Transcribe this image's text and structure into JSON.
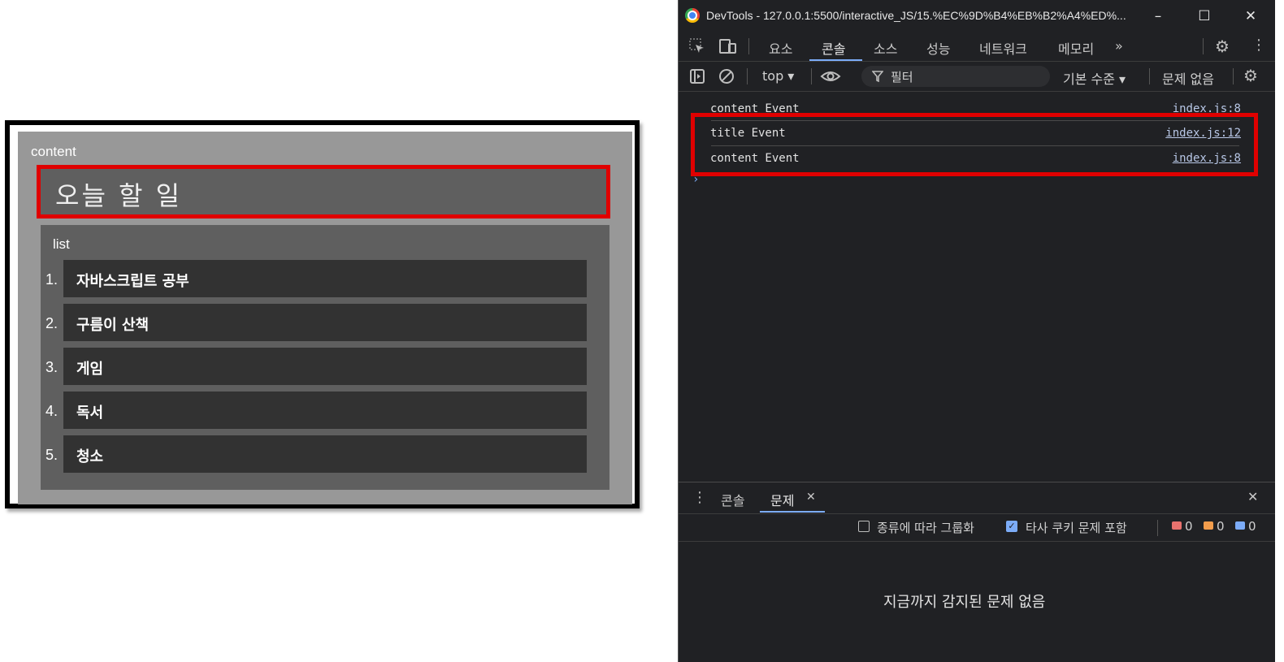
{
  "preview": {
    "content_label": "content",
    "title": "오늘 할 일",
    "list_label": "list",
    "items": [
      {
        "num": "1.",
        "text": "자바스크립트 공부"
      },
      {
        "num": "2.",
        "text": "구름이 산책"
      },
      {
        "num": "3.",
        "text": "게임"
      },
      {
        "num": "4.",
        "text": "독서"
      },
      {
        "num": "5.",
        "text": "청소"
      }
    ]
  },
  "devtools": {
    "window_title": "DevTools - 127.0.0.1:5500/interactive_JS/15.%EC%9D%B4%EB%B2%A4%ED%...",
    "win_controls": {
      "minimize": "–",
      "maximize": "☐",
      "close": "✕"
    },
    "tabs": [
      "요소",
      "콘솔",
      "소스",
      "성능",
      "네트워크",
      "메모리"
    ],
    "active_tab": "콘솔",
    "more_tabs": "»",
    "context": "top ▾",
    "filter_placeholder": "필터",
    "level": "기본 수준 ▾",
    "issues_status": "문제 없음",
    "logs": [
      {
        "msg": "content Event",
        "src": "index.js:8"
      },
      {
        "msg": "title Event",
        "src": "index.js:12"
      },
      {
        "msg": "content Event",
        "src": "index.js:8"
      }
    ],
    "prompt": "›",
    "drawer_tabs": {
      "console": "콘솔",
      "issues": "문제",
      "close_tab": "✕"
    },
    "drawer_close": "✕",
    "issues_options": {
      "group_by_kind": "종류에 따라 그룹화",
      "include_third_party": "타사 쿠키 문제 포함",
      "include_third_party_checked": true
    },
    "counts": {
      "errors": "0",
      "warnings": "0",
      "info": "0"
    },
    "no_issues_text": "지금까지 감지된 문제 없음",
    "colors": {
      "accent": "#7cacf8",
      "highlight": "#e00000"
    }
  }
}
